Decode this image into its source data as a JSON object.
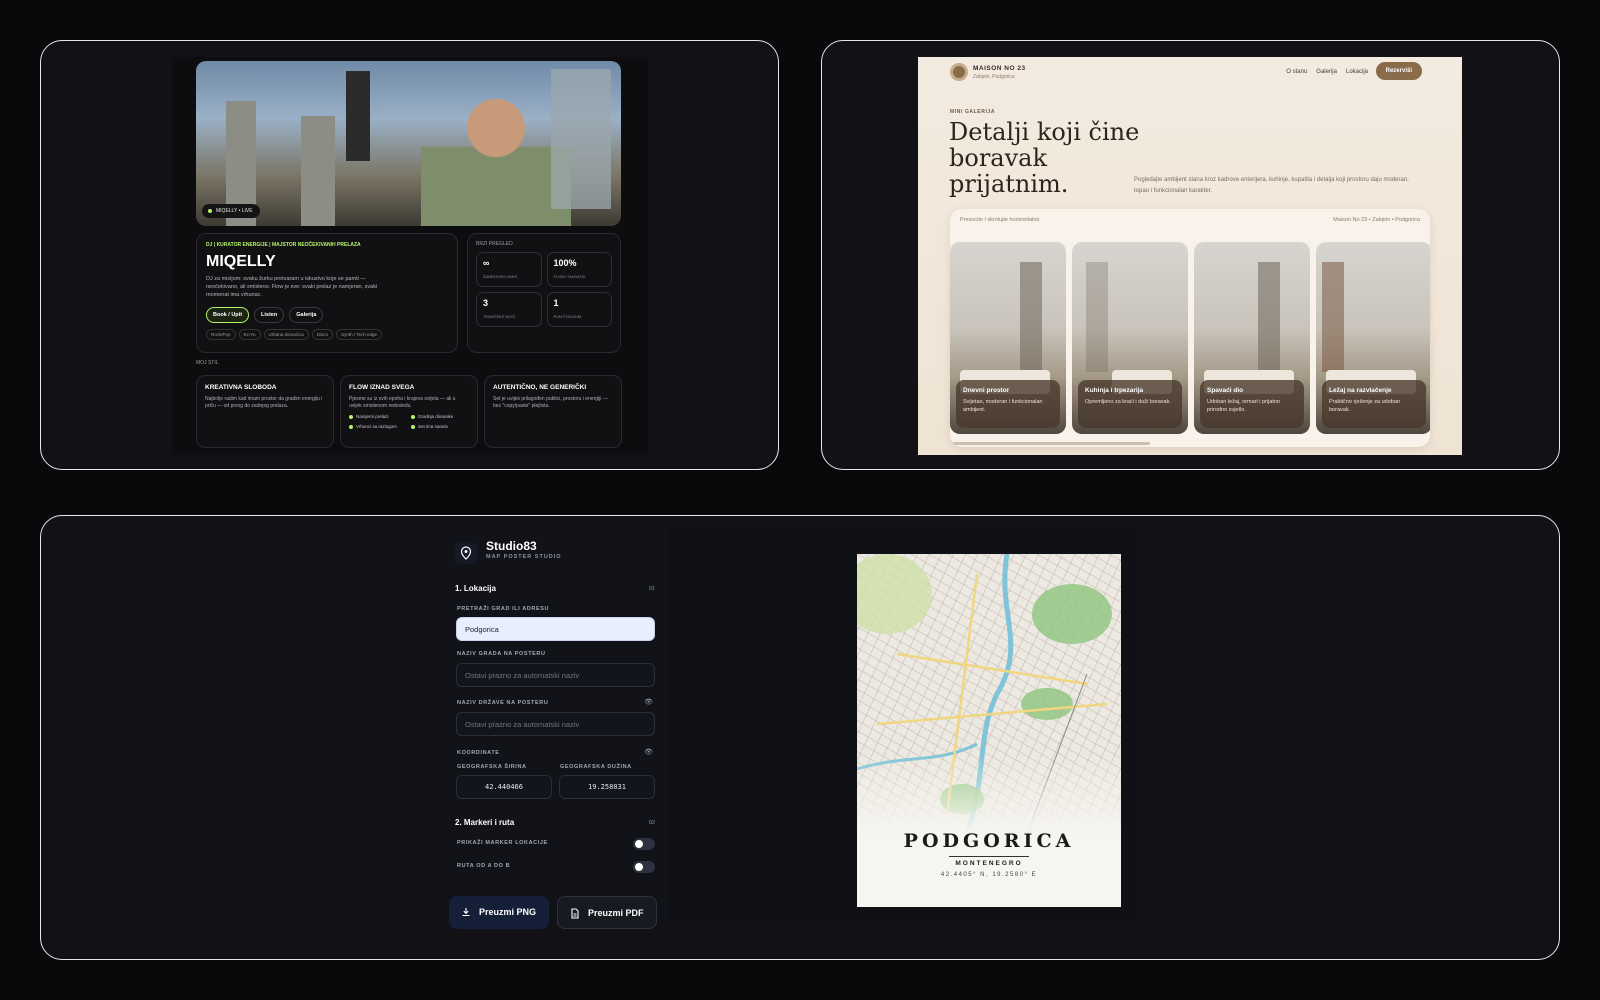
{
  "dj": {
    "hero_badge": "MIQELLY • LIVE",
    "kicker": "DJ | KURATOR ENERGIJE | MAJSTOR NEOČEKIVANIH PRELAZA",
    "name": "MIQELLY",
    "description": "DJ za misijom: svaku žurku pretvaram u iskustvo koje se pamti — neočekivano, ali smisleno. Flow je sve: svaki prelaz je namjeran, svaki momenat ima vrhunac.",
    "buttons": [
      "Book / Upit",
      "Listen",
      "Galerija"
    ],
    "tags": [
      "Rock/Pop",
      "Ex-Yu",
      "Urbana domaćica",
      "Disco",
      "Synth / Tech edge"
    ],
    "stats_title": "BRZI PREGLED",
    "stats": [
      {
        "value": "∞",
        "label": "ŽANROVSKI MIKS"
      },
      {
        "value": "100%",
        "label": "FLOW / NARATIV"
      },
      {
        "value": "3",
        "label": "TEMATSKE NOĆI"
      },
      {
        "value": "1",
        "label": "PUN PODIJUM"
      }
    ],
    "style_title": "MOJ STIL",
    "cards": [
      {
        "title": "KREATIVNA SLOBODA",
        "text": "Najbolje radim kad imam prostor da gradim energiju i priču — od prvog do zadnjeg prelaza."
      },
      {
        "title": "FLOW IZNAD SVEGA",
        "text": "Pjesme su iz svih epoha i krajeva svijeta — ali u uvijek smislenom redosledu.",
        "bullets": [
          "Namjerni prelazi",
          "Gradnja dinamike",
          "Vrhunci sa razlogom",
          "Set ima narativ"
        ]
      },
      {
        "title": "AUTENTIČNO, NE GENERIČKI",
        "text": "Set je uvijek prilagođen publici, prostoru i energiji — bez \"copy/paste\" plejlista."
      }
    ],
    "accent": "#b6f46a"
  },
  "maison": {
    "brand": "MAISON NO 23",
    "location": "Zabjelo, Podgorica",
    "nav": [
      "O stanu",
      "Galerija",
      "Lokacija"
    ],
    "reserve": "Rezerviši",
    "kicker": "MINI GALERIJA",
    "title": "Detalji koji čine boravak prijatnim.",
    "lead": "Pogledajte ambijent stana kroz kadrove enterijera, kuhinje, kupatila i detalja koji prostoru daju moderan, topao i funkcionalan karakter.",
    "gallery_hint": "Prevucite / skrolujte horizontalno",
    "gallery_location": "Maison No 23 • Zabjelo • Podgorica",
    "photos": [
      {
        "title": "Dnevni prostor",
        "text": "Svijetao, moderan i funkcionalan ambijent."
      },
      {
        "title": "Kuhinja i trpezarija",
        "text": "Opremljeno za kraći i duži boravak."
      },
      {
        "title": "Spavaći dio",
        "text": "Udoban ležaj, ormari i prijatno prirodno svjetlo."
      },
      {
        "title": "Ležaj na razvlačenje",
        "text": "Praktično rješenje za udoban boravak."
      }
    ],
    "accent": "#8a6b4a"
  },
  "studio": {
    "app_name": "Studio83",
    "app_sub": "MAP POSTER STUDIO",
    "section1": "1. Lokacija",
    "section1_num": "01",
    "search_label": "PRETRAŽI GRAD ILI ADRESU",
    "search_value": "Podgorica",
    "city_label": "NAZIV GRADA NA POSTERU",
    "city_placeholder": "Ostavi prazno za automatski naziv",
    "country_label": "NAZIV DRŽAVE NA POSTERU",
    "country_placeholder": "Ostavi prazno za automatski naziv",
    "coords_label": "KOORDINATE",
    "lat_label": "GEOGRAFSKA ŠIRINA",
    "lat_value": "42.440466",
    "lon_label": "GEOGRAFSKA DUŽINA",
    "lon_value": "19.258031",
    "section2": "2. Markeri i ruta",
    "section2_num": "02",
    "marker_label": "PRIKAŽI MARKER LOKACIJE",
    "route_label": "RUTA OD A DO B",
    "btn_png": "Preuzmi PNG",
    "btn_pdf": "Preuzmi PDF",
    "poster_city": "PODGORICA",
    "poster_country": "MONTENEGRO",
    "poster_coords": "42.4405° N, 19.2580° E"
  }
}
